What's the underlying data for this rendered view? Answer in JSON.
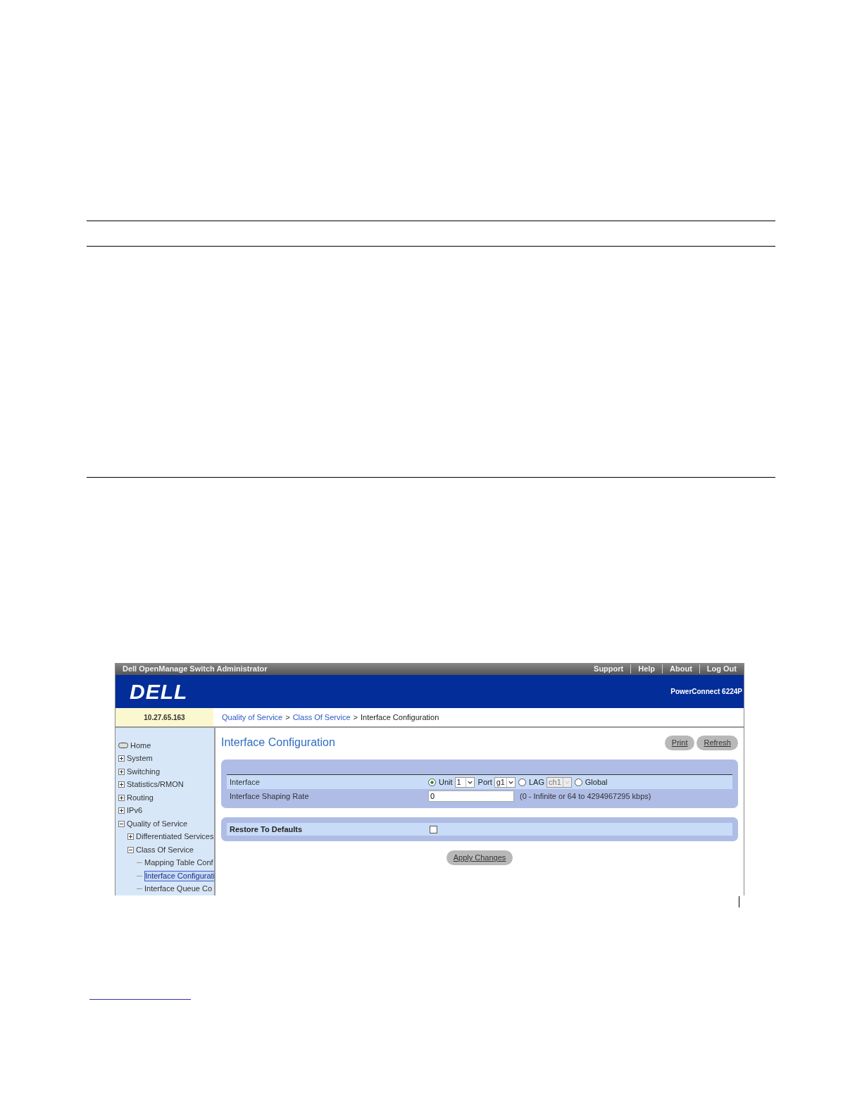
{
  "app": {
    "title": "Dell OpenManage Switch Administrator",
    "links": [
      "Support",
      "Help",
      "About",
      "Log Out"
    ],
    "logo": "DELL",
    "product": "PowerConnect 6224P",
    "address": "10.27.65.163"
  },
  "breadcrumb": {
    "separator": ">",
    "items": [
      {
        "label": "Quality of Service",
        "link": true
      },
      {
        "label": "Class Of Service",
        "link": true
      },
      {
        "label": "Interface Configuration",
        "link": false
      }
    ]
  },
  "sidebar": {
    "items": [
      {
        "label": "Home",
        "kind": "home",
        "selected": false
      },
      {
        "label": "System",
        "kind": "folder",
        "expanded": false,
        "selected": false
      },
      {
        "label": "Switching",
        "kind": "folder",
        "expanded": false,
        "selected": false
      },
      {
        "label": "Statistics/RMON",
        "kind": "folder",
        "expanded": false,
        "selected": false
      },
      {
        "label": "Routing",
        "kind": "folder",
        "expanded": false,
        "selected": false
      },
      {
        "label": "IPv6",
        "kind": "folder",
        "expanded": false,
        "selected": false
      },
      {
        "label": "Quality of Service",
        "kind": "folder",
        "expanded": true,
        "selected": false,
        "children": [
          {
            "label": "Differentiated Services",
            "kind": "folder",
            "expanded": false,
            "selected": false
          },
          {
            "label": "Class Of Service",
            "kind": "folder",
            "expanded": true,
            "selected": false,
            "children": [
              {
                "label": "Mapping Table Conf",
                "kind": "page",
                "selected": false
              },
              {
                "label": "Interface Configurati",
                "kind": "page",
                "selected": true
              },
              {
                "label": "Interface Queue Co",
                "kind": "page",
                "selected": false
              }
            ]
          }
        ]
      }
    ]
  },
  "page": {
    "title": "Interface Configuration",
    "buttons": [
      "Print",
      "Refresh"
    ],
    "interface": {
      "label": "Interface",
      "options": [
        {
          "kind": "radio",
          "label": "Unit",
          "selected": true,
          "select": "1",
          "disabled": false
        },
        {
          "kind": "plain",
          "label": "Port",
          "select": "g1",
          "disabled": false
        },
        {
          "kind": "radio",
          "label": "LAG",
          "selected": false,
          "select": "ch1",
          "disabled": true
        },
        {
          "kind": "radio",
          "label": "Global",
          "selected": false
        }
      ]
    },
    "shaping": {
      "label": "Interface Shaping Rate",
      "value": "0",
      "hint": "(0 - Infinite or 64 to 4294967295 kbps)"
    },
    "restore": {
      "label": "Restore To Defaults",
      "checked": false
    },
    "apply": "Apply Changes"
  }
}
